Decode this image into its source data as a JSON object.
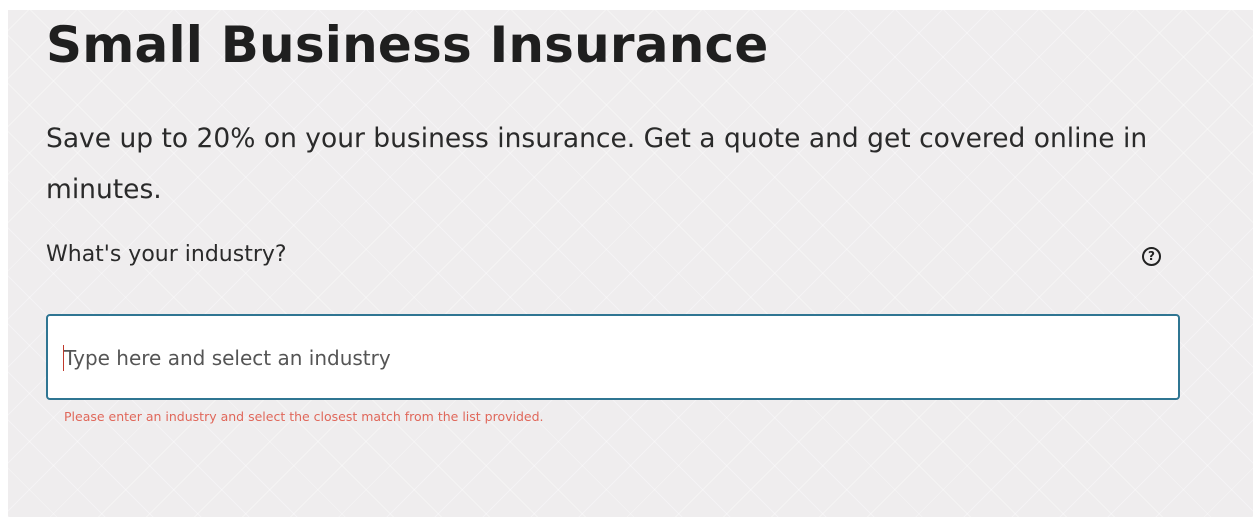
{
  "page": {
    "title": "Small Business Insurance",
    "subtitle": "Save up to 20% on your business insurance. Get a quote and get covered online in minutes."
  },
  "form": {
    "question_label": "What's your industry?",
    "help_icon_glyph": "?",
    "industry_input": {
      "value": "",
      "placeholder": "Type here and select an industry"
    },
    "error_message": "Please enter an industry and select the closest match from the list provided."
  },
  "colors": {
    "input_border": "#2f7592",
    "error_text": "#e0675a",
    "background": "#efedee"
  }
}
